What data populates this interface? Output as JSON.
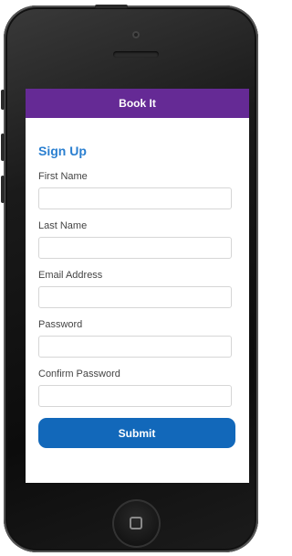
{
  "app": {
    "title": "Book It"
  },
  "form": {
    "heading": "Sign Up",
    "fields": [
      {
        "label": "First Name",
        "value": "",
        "placeholder": ""
      },
      {
        "label": "Last Name",
        "value": "",
        "placeholder": ""
      },
      {
        "label": "Email Address",
        "value": "",
        "placeholder": ""
      },
      {
        "label": "Password",
        "value": "",
        "placeholder": ""
      },
      {
        "label": "Confirm Password",
        "value": "",
        "placeholder": ""
      }
    ],
    "submit_label": "Submit"
  },
  "colors": {
    "header_bg": "#652a95",
    "heading_text": "#2a7fd0",
    "submit_bg": "#1268ba"
  },
  "icons": {
    "home_button": "home-button-icon"
  }
}
